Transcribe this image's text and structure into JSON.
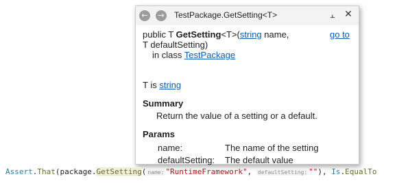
{
  "popup": {
    "title": "TestPackage.GetSetting<T>",
    "back_icon": "arrow-left-icon",
    "forward_icon": "arrow-right-icon",
    "pin_icon": "pin-icon",
    "close_icon": "close-icon",
    "back_glyph": "←",
    "forward_glyph": "→",
    "pin_glyph": "⫠",
    "close_glyph": "✕",
    "signature": {
      "prefix": "public T ",
      "method": "GetSetting",
      "generic": "<T>(",
      "param1_type": "string",
      "param1_rest": " name,",
      "line2": "T defaultSetting)",
      "goto": "go to",
      "in_class_prefix": "in class ",
      "class_name": "TestPackage"
    },
    "type_param": {
      "prefix": "T is ",
      "value": "string"
    },
    "summary": {
      "heading": "Summary",
      "text": "Return the value of a setting or a default."
    },
    "params": {
      "heading": "Params",
      "rows": [
        {
          "name": "name:",
          "desc": "The name of the setting"
        },
        {
          "name": "defaultSetting:",
          "desc": "The default value"
        }
      ]
    }
  },
  "code": {
    "t1": "Assert",
    "t2": ".",
    "t3": "That",
    "t4": "(package.",
    "t5": "GetSetting",
    "t6": "(",
    "hint1": "name:",
    "s1": "\"RuntimeFramework\"",
    "t7": ", ",
    "hint2": "defaultSetting:",
    "s2": "\"\"",
    "t8": "), ",
    "t9": "Is",
    "t10": ".",
    "t11": "EqualTo"
  },
  "colors": {
    "link": "#0b5cad",
    "type": "#2b7d9b",
    "string": "#a31515",
    "method": "#6b6b2a"
  }
}
